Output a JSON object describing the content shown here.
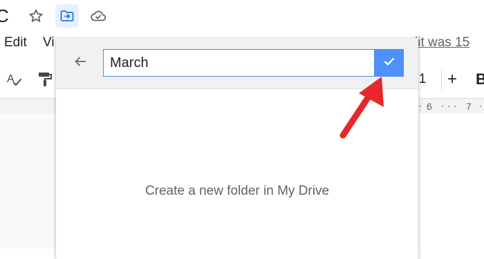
{
  "header": {
    "title_fragment": "C",
    "star_icon": "star-outline-icon",
    "move_icon": "move-to-folder-icon",
    "cloud_icon": "cloud-check-icon"
  },
  "menu": {
    "edit_label": "Edit",
    "view_fragment": "Vi",
    "last_edit_fragment": "lit was 15"
  },
  "toolbar": {
    "spellcheck_icon": "spellcheck-icon",
    "paint_format_icon": "paint-format-icon",
    "font_size": "1",
    "increase_font_label": "+",
    "bold_fragment": "B"
  },
  "ruler": {
    "marks": [
      "6",
      "7"
    ]
  },
  "move_dialog": {
    "back_icon": "arrow-left-icon",
    "folder_name_value": "March",
    "confirm_icon": "check-icon",
    "message": "Create a new folder in My Drive"
  },
  "colors": {
    "confirm_button": "#4d90fe",
    "input_border": "#4a89dc",
    "annotation_arrow": "#e8262c",
    "move_icon_active_bg": "#e8f0fe",
    "move_icon": "#1a73e8"
  }
}
